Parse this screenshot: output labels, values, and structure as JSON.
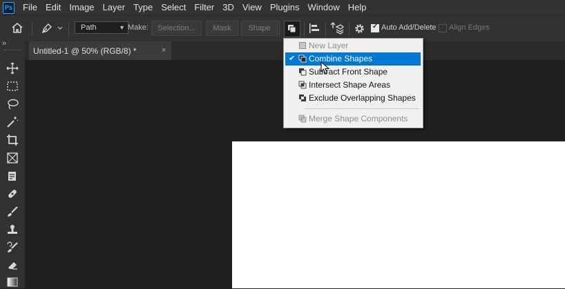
{
  "app": {
    "logo_text": "Ps"
  },
  "menubar": {
    "items": [
      "File",
      "Edit",
      "Image",
      "Layer",
      "Type",
      "Select",
      "Filter",
      "3D",
      "View",
      "Plugins",
      "Window",
      "Help"
    ]
  },
  "options_bar": {
    "mode_select": "Path",
    "make_label": "Make:",
    "selection_button": "Selection...",
    "mask_button": "Mask",
    "shape_button": "Shape",
    "auto_add_delete": {
      "label": "Auto Add/Delete",
      "checked": true
    },
    "align_edges": {
      "label": "Align Edges",
      "checked": false
    }
  },
  "document_tab": {
    "title": "Untitled-1 @ 50% (RGB/8) *",
    "close_symbol": "×"
  },
  "toolpanel": {
    "collapse_symbol": "»",
    "tools": [
      "move-tool",
      "marquee-tool",
      "lasso-tool",
      "magic-wand-tool",
      "crop-tool",
      "frame-tool",
      "eyedropper-tool",
      "healing-brush-tool",
      "brush-tool",
      "clone-stamp-tool",
      "history-brush-tool",
      "eraser-tool",
      "gradient-tool"
    ]
  },
  "path_operations_menu": {
    "items": [
      {
        "label": "New Layer",
        "enabled": false,
        "checked": false
      },
      {
        "label": "Combine Shapes",
        "enabled": true,
        "checked": true,
        "highlighted": true
      },
      {
        "label": "Subtract Front Shape",
        "enabled": true,
        "checked": false
      },
      {
        "label": "Intersect Shape Areas",
        "enabled": true,
        "checked": false
      },
      {
        "label": "Exclude Overlapping Shapes",
        "enabled": true,
        "checked": false
      },
      {
        "label": "Merge Shape Components",
        "enabled": false,
        "checked": false
      }
    ]
  },
  "colors": {
    "menu_highlight": "#0078d7",
    "canvas": "#ffffff",
    "workspace": "#1f1f1f",
    "panel": "#323232"
  }
}
